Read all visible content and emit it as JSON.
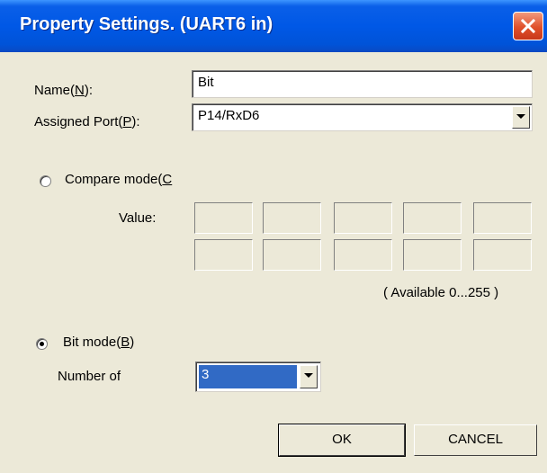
{
  "window": {
    "title": "Property Settings. (UART6 in)"
  },
  "form": {
    "name_label": "Name(N):",
    "name_value": "Bit",
    "port_label": "Assigned Port(P):",
    "port_value": "P14/RxD6",
    "compare_mode_label": "Compare mode(C",
    "value_label": "Value:",
    "available_note": "( Available 0...255 )",
    "bit_mode_label": "Bit mode(B)",
    "number_of_label": "Number of",
    "number_of_value": "3",
    "selected_mode": "bit"
  },
  "buttons": {
    "ok": "OK",
    "cancel": "CANCEL"
  },
  "icons": {
    "close": "close-icon",
    "dropdown": "chevron-down-icon"
  },
  "colors": {
    "titlebar": "#0058E6",
    "close": "#E0502A",
    "selection": "#316AC5",
    "face": "#ECE9D8"
  }
}
